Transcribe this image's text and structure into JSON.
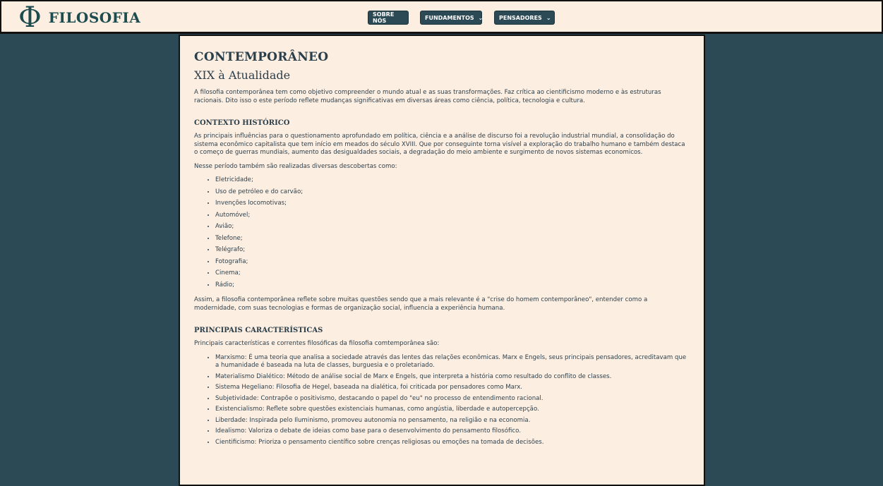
{
  "header": {
    "logo_glyph": "Φ",
    "logo_text": "FILOSOFIA",
    "nav": [
      {
        "label": "SOBRE NÓS",
        "has_dropdown": false
      },
      {
        "label": "FUNDAMENTOS",
        "has_dropdown": true
      },
      {
        "label": "PENSADORES",
        "has_dropdown": true
      }
    ],
    "chevron_glyph": "⌄"
  },
  "article": {
    "title": "CONTEMPORÂNEO",
    "subtitle": "XIX à Atualidade",
    "intro": "A filosofia contemporânea tem como objetivo compreender o mundo atual e as suas transformações. Faz crítica ao cientificismo moderno e às estruturas racionais. Dito isso o este período reflete mudanças significativas em diversas áreas como ciência, política, tecnologia e cultura.",
    "section1": {
      "heading": "CONTEXTO HISTÓRICO",
      "p1": "As principais influências para o questionamento aprofundado em política, ciência e a análise de discurso foi a revolução industrial mundial, a consolidação do sistema econômico capitalista que tem início em meados do século XVIII. Que por conseguinte torna visível a exploração do trabalho humano e também destaca o começo de guerras mundiais, aumento das desigualdades sociais, a degradação do meio ambiente e surgimento de novos sistemas economicos.",
      "p2": "Nesse período também são realizadas diversas descobertas como:",
      "list": [
        "Eletricidade;",
        "Uso de petróleo e do carvão;",
        "Invenções locomotivas;",
        "Automóvel;",
        "Avião;",
        "Telefone;",
        "Telégrafo;",
        "Fotografia;",
        "Cinema;",
        "Rádio;"
      ],
      "p3": "Assim, a filosofia contemporânea reflete sobre muitas questões sendo que a mais relevante é a \"crise do homem contemporâneo\", entender como a modernidade, com suas tecnologias e formas de organização social, influencia a experiência humana."
    },
    "section2": {
      "heading": "PRINCIPAIS CARACTERÍSTICAS",
      "p1": "Principais características e correntes filosóficas da filosofia comtemporânea são:",
      "list": [
        "Marxismo: É uma teoria que analisa a sociedade através das lentes das relações econômicas. Marx e Engels, seus principais pensadores, acreditavam que a humanidade é baseada na luta de classes, burguesia e o proletariado.",
        "Materialismo Dialético: Método de análise social de Marx e Engels, que interpreta a história como resultado do conflito de classes.",
        "Sistema Hegeliano: Filosofia de Hegel, baseada na dialética, foi criticada por pensadores como Marx.",
        "Subjetividade: Contrapõe o positivismo, destacando o papel do \"eu\" no processo de entendimento racional.",
        "Existencialismo: Reflete sobre questões existenciais humanas, como angústia, liberdade e autopercepção.",
        "Liberdade: Inspirada pelo Iluminismo, promoveu autonomia no pensamento, na religião e na economia.",
        "Idealismo: Valoriza o debate de ideias como base para o desenvolvimento do pensamento filosófico.",
        "Cientificismo: Prioriza o pensamento científico sobre crenças religiosas ou emoções na tomada de decisões."
      ]
    }
  },
  "colors": {
    "page_bg": "#2b4a55",
    "panel_bg": "#fdeee2",
    "accent": "#1d4c4e"
  }
}
